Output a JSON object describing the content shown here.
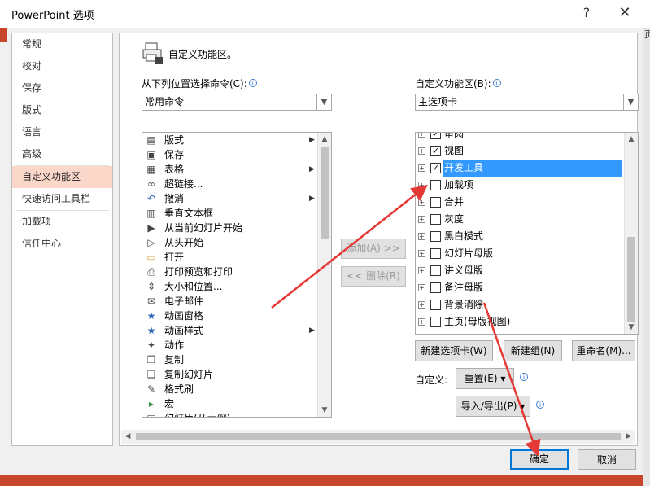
{
  "window": {
    "title": "PowerPoint 选项",
    "help": "?",
    "close": "✕"
  },
  "background": {
    "right_edge_text": "页"
  },
  "nav": {
    "items": [
      "常规",
      "校对",
      "保存",
      "版式",
      "语言",
      "高级",
      "自定义功能区",
      "快速访问工具栏",
      "加载项",
      "信任中心"
    ],
    "active_index": 6
  },
  "header": {
    "title": "自定义功能区。"
  },
  "left": {
    "label": "从下列位置选择命令(C):",
    "combo_value": "常用命令",
    "items": [
      {
        "label": "版式",
        "icon": "layout-icon",
        "sub": true
      },
      {
        "label": "保存",
        "icon": "save-icon",
        "sub": false
      },
      {
        "label": "表格",
        "icon": "table-icon",
        "sub": true
      },
      {
        "label": "超链接...",
        "icon": "hyperlink-icon",
        "sub": false
      },
      {
        "label": "撤消",
        "icon": "undo-icon",
        "sub": true
      },
      {
        "label": "垂直文本框",
        "icon": "vertical-textbox-icon",
        "sub": false
      },
      {
        "label": "从当前幻灯片开始",
        "icon": "slideshow-current-icon",
        "sub": false
      },
      {
        "label": "从头开始",
        "icon": "slideshow-start-icon",
        "sub": false
      },
      {
        "label": "打开",
        "icon": "open-folder-icon",
        "sub": false
      },
      {
        "label": "打印预览和打印",
        "icon": "print-preview-icon",
        "sub": false
      },
      {
        "label": "大小和位置...",
        "icon": "size-position-icon",
        "sub": false
      },
      {
        "label": "电子邮件",
        "icon": "email-icon",
        "sub": false
      },
      {
        "label": "动画窗格",
        "icon": "animation-pane-icon",
        "sub": false
      },
      {
        "label": "动画样式",
        "icon": "animation-style-icon",
        "sub": true
      },
      {
        "label": "动作",
        "icon": "action-icon",
        "sub": false
      },
      {
        "label": "复制",
        "icon": "copy-icon",
        "sub": false
      },
      {
        "label": "复制幻灯片",
        "icon": "duplicate-slide-icon",
        "sub": false
      },
      {
        "label": "格式刷",
        "icon": "format-painter-icon",
        "sub": false
      },
      {
        "label": "宏",
        "icon": "macro-icon",
        "sub": false
      },
      {
        "label": "幻灯片(从大纲)...",
        "icon": "slides-outline-icon",
        "sub": false
      }
    ]
  },
  "middle": {
    "add": "添加(A) >>",
    "remove": "<< 删除(R)"
  },
  "right": {
    "label": "自定义功能区(B):",
    "combo_value": "主选项卡",
    "items": [
      {
        "label": "审阅",
        "checked": true,
        "selected": false
      },
      {
        "label": "视图",
        "checked": true,
        "selected": false
      },
      {
        "label": "开发工具",
        "checked": true,
        "selected": true
      },
      {
        "label": "加载项",
        "checked": false,
        "selected": false
      },
      {
        "label": "合并",
        "checked": false,
        "selected": false
      },
      {
        "label": "灰度",
        "checked": false,
        "selected": false
      },
      {
        "label": "黑白模式",
        "checked": false,
        "selected": false
      },
      {
        "label": "幻灯片母版",
        "checked": false,
        "selected": false
      },
      {
        "label": "讲义母版",
        "checked": false,
        "selected": false
      },
      {
        "label": "备注母版",
        "checked": false,
        "selected": false
      },
      {
        "label": "背景消除",
        "checked": false,
        "selected": false
      },
      {
        "label": "主页(母版视图)",
        "checked": false,
        "selected": false
      }
    ],
    "new_tab": "新建选项卡(W)",
    "new_group": "新建组(N)",
    "rename": "重命名(M)...",
    "customize_label": "自定义:",
    "reset": "重置(E) ▾",
    "import_export": "导入/导出(P) ▾"
  },
  "footer": {
    "ok": "确定",
    "cancel": "取消"
  },
  "colors": {
    "accent": "#0078d7",
    "active_nav": "#fbd7c9",
    "selection": "#3399ff",
    "annotation_arrow": "#e53935"
  }
}
